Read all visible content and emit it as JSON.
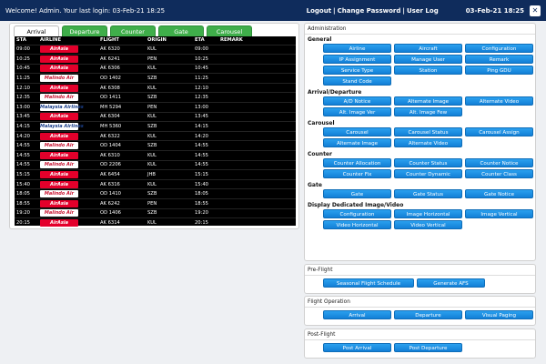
{
  "header": {
    "welcome": "Welcome! Admin. Your last login: 03-Feb-21 18:25",
    "logout": "Logout",
    "change_password": "Change Password",
    "user_log": "User Log",
    "datetime": "03-Feb-21  18:25",
    "close_icon": "close-icon"
  },
  "tabs": [
    "Arrival",
    "Departure",
    "Counter",
    "Gate",
    "Carousel"
  ],
  "board": {
    "columns": [
      "STA",
      "AIRLINE",
      "FLIGHT",
      "ORIGIN",
      "ETA",
      "REMARK"
    ],
    "rows": [
      {
        "sta": "09:00",
        "logo": "airasia",
        "logo_text": "AirAsia",
        "flight": "AK 6320",
        "origin": "KUL",
        "eta": "09:00",
        "remark": ""
      },
      {
        "sta": "10:25",
        "logo": "airasia",
        "logo_text": "AirAsia",
        "flight": "AK 6241",
        "origin": "PEN",
        "eta": "10:25",
        "remark": ""
      },
      {
        "sta": "10:45",
        "logo": "airasia",
        "logo_text": "AirAsia",
        "flight": "AK 6306",
        "origin": "KUL",
        "eta": "10:45",
        "remark": ""
      },
      {
        "sta": "11:25",
        "logo": "malindo",
        "logo_text": "Malindo Air",
        "flight": "OD 1402",
        "origin": "SZB",
        "eta": "11:25",
        "remark": ""
      },
      {
        "sta": "12:10",
        "logo": "airasia",
        "logo_text": "AirAsia",
        "flight": "AK 6308",
        "origin": "KUL",
        "eta": "12:10",
        "remark": ""
      },
      {
        "sta": "12:35",
        "logo": "malindo",
        "logo_text": "Malindo Air",
        "flight": "OD 1411",
        "origin": "SZB",
        "eta": "12:35",
        "remark": ""
      },
      {
        "sta": "13:00",
        "logo": "mas",
        "logo_text": "Malaysia Airlines",
        "flight": "MH 5294",
        "origin": "PEN",
        "eta": "13:00",
        "remark": ""
      },
      {
        "sta": "13:45",
        "logo": "airasia",
        "logo_text": "AirAsia",
        "flight": "AK 6304",
        "origin": "KUL",
        "eta": "13:45",
        "remark": ""
      },
      {
        "sta": "14:15",
        "logo": "mas",
        "logo_text": "Malaysia Airlines",
        "flight": "MH 5360",
        "origin": "SZB",
        "eta": "14:15",
        "remark": ""
      },
      {
        "sta": "14:20",
        "logo": "airasia",
        "logo_text": "AirAsia",
        "flight": "AK 6322",
        "origin": "KUL",
        "eta": "14:20",
        "remark": ""
      },
      {
        "sta": "14:55",
        "logo": "malindo",
        "logo_text": "Malindo Air",
        "flight": "OD 1404",
        "origin": "SZB",
        "eta": "14:55",
        "remark": ""
      },
      {
        "sta": "14:55",
        "logo": "airasia",
        "logo_text": "AirAsia",
        "flight": "AK 6310",
        "origin": "KUL",
        "eta": "14:55",
        "remark": ""
      },
      {
        "sta": "14:55",
        "logo": "malindo",
        "logo_text": "Malindo Air",
        "flight": "OD 2206",
        "origin": "KUL",
        "eta": "14:55",
        "remark": ""
      },
      {
        "sta": "15:15",
        "logo": "airasia",
        "logo_text": "AirAsia",
        "flight": "AK 6454",
        "origin": "JHB",
        "eta": "15:15",
        "remark": ""
      },
      {
        "sta": "15:40",
        "logo": "airasia",
        "logo_text": "AirAsia",
        "flight": "AK 6316",
        "origin": "KUL",
        "eta": "15:40",
        "remark": ""
      },
      {
        "sta": "18:05",
        "logo": "malindo",
        "logo_text": "Malindo Air",
        "flight": "OD 1410",
        "origin": "SZB",
        "eta": "18:05",
        "remark": ""
      },
      {
        "sta": "18:55",
        "logo": "airasia",
        "logo_text": "AirAsia",
        "flight": "AK 6242",
        "origin": "PEN",
        "eta": "18:55",
        "remark": ""
      },
      {
        "sta": "19:20",
        "logo": "malindo",
        "logo_text": "Malindo Air",
        "flight": "OD 1406",
        "origin": "SZB",
        "eta": "19:20",
        "remark": ""
      },
      {
        "sta": "20:15",
        "logo": "airasia",
        "logo_text": "AirAsia",
        "flight": "AK 6314",
        "origin": "KUL",
        "eta": "20:15",
        "remark": ""
      }
    ]
  },
  "admin": {
    "title": "Administration",
    "sections": [
      {
        "title": "General",
        "rows": [
          [
            "Airline",
            "Aircraft",
            "Configuration"
          ],
          [
            "IP Assignment",
            "Manage User",
            "Remark"
          ],
          [
            "Service Type",
            "Station",
            "Ping GDU"
          ],
          [
            "Stand Code"
          ]
        ]
      },
      {
        "title": "Arrival/Departure",
        "rows": [
          [
            "A/D Notice",
            "Alternate Image",
            "Alternate Video"
          ],
          [
            "Alt. Image Ver",
            "Alt. Image Few"
          ]
        ]
      },
      {
        "title": "Carousel",
        "rows": [
          [
            "Carousel",
            "Carousel Status",
            "Carousel Assign"
          ],
          [
            "Alternate Image",
            "Alternate Video"
          ]
        ]
      },
      {
        "title": "Counter",
        "rows": [
          [
            "Counter Allocation",
            "Counter Status",
            "Counter Notice"
          ],
          [
            "Counter Fix",
            "Counter Dynamic",
            "Counter Class"
          ]
        ]
      },
      {
        "title": "Gate",
        "rows": [
          [
            "Gate",
            "Gate Status",
            "Gate Notice"
          ]
        ]
      },
      {
        "title": "Display Dedicated Image/Video",
        "rows": [
          [
            "Configuration",
            "Image Horizontal",
            "Image Vertical"
          ],
          [
            "Video Horizontal",
            "Video Vertical"
          ]
        ]
      }
    ]
  },
  "preflight": {
    "title": "Pre-Flight",
    "buttons": [
      "Seasonal Flight Schedule",
      "Generate AFS"
    ]
  },
  "flightops": {
    "title": "Flight Operation",
    "buttons": [
      "Arrival",
      "Departure",
      "Visual Paging"
    ]
  },
  "postflight": {
    "title": "Post-Flight",
    "buttons": [
      "Post Arrival",
      "Post Departure"
    ]
  },
  "colors": {
    "header": "#0f2c5c",
    "tab_green": "#3fae4a",
    "button_blue": "#1b8fe3",
    "airasia_red": "#e4002b"
  }
}
